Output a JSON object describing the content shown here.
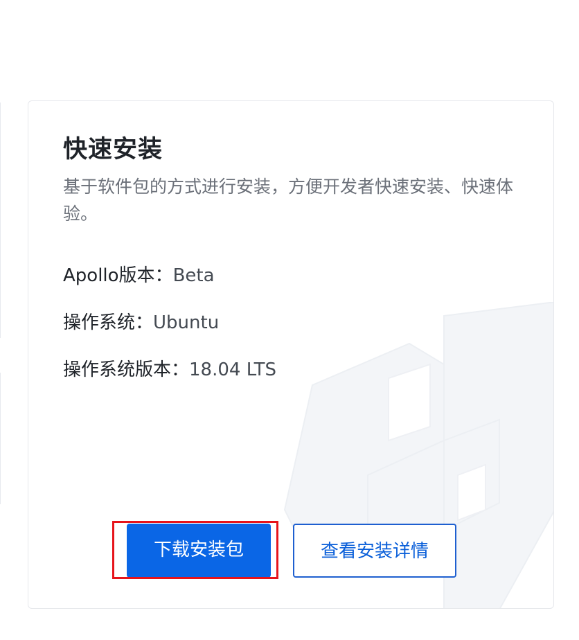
{
  "card": {
    "title": "快速安装",
    "description": "基于软件包的方式进行安装，方便开发者快速安装、快速体验。",
    "info": [
      {
        "label": "Apollo版本：",
        "value": "Beta"
      },
      {
        "label": "操作系统：",
        "value": "Ubuntu"
      },
      {
        "label": "操作系统版本：",
        "value": "18.04 LTS"
      }
    ],
    "buttons": {
      "download_label": "下载安装包",
      "details_label": "查看安装详情"
    }
  },
  "colors": {
    "primary": "#0a66e6",
    "outline_border": "#1e5fd0",
    "highlight": "#e6141b",
    "title_text": "#1f2329",
    "desc_text": "#6b7079"
  }
}
